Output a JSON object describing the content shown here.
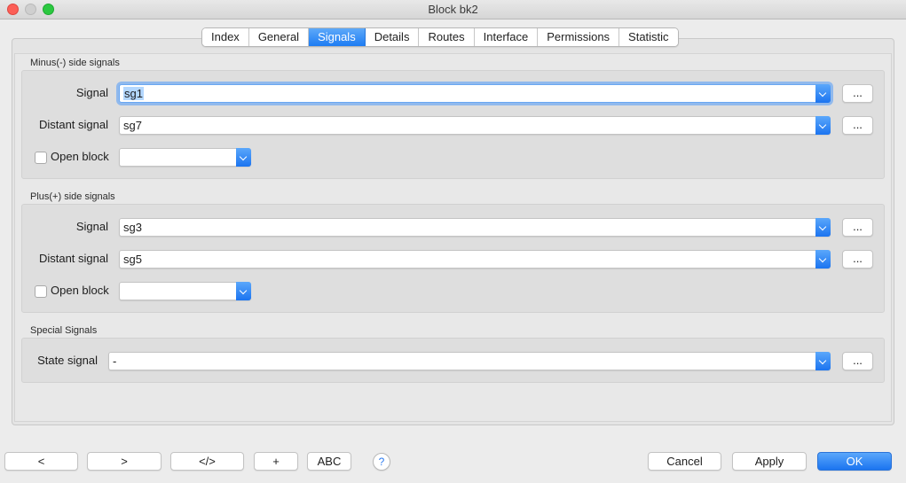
{
  "window": {
    "title": "Block bk2"
  },
  "tabs": [
    {
      "label": "Index"
    },
    {
      "label": "General"
    },
    {
      "label": "Signals",
      "active": true
    },
    {
      "label": "Details"
    },
    {
      "label": "Routes"
    },
    {
      "label": "Interface"
    },
    {
      "label": "Permissions"
    },
    {
      "label": "Statistic"
    }
  ],
  "minus": {
    "title": "Minus(-) side signals",
    "signal_label": "Signal",
    "signal_value": "sg1",
    "distant_label": "Distant signal",
    "distant_value": "sg7",
    "openblock_label": "Open block",
    "openblock_checked": false,
    "openblock_value": ""
  },
  "plus": {
    "title": "Plus(+) side signals",
    "signal_label": "Signal",
    "signal_value": "sg3",
    "distant_label": "Distant signal",
    "distant_value": "sg5",
    "openblock_label": "Open block",
    "openblock_checked": false,
    "openblock_value": ""
  },
  "special": {
    "title": "Special Signals",
    "state_label": "State signal",
    "state_value": "-"
  },
  "browse_label": "...",
  "bottom": {
    "prev": "<",
    "next": ">",
    "code": "</>",
    "add": "+",
    "abc": "ABC",
    "help": "?",
    "cancel": "Cancel",
    "apply": "Apply",
    "ok": "OK"
  },
  "colors": {
    "accent": "#1d7cf3",
    "close": "#fc5f57",
    "zoom": "#2bc840"
  }
}
